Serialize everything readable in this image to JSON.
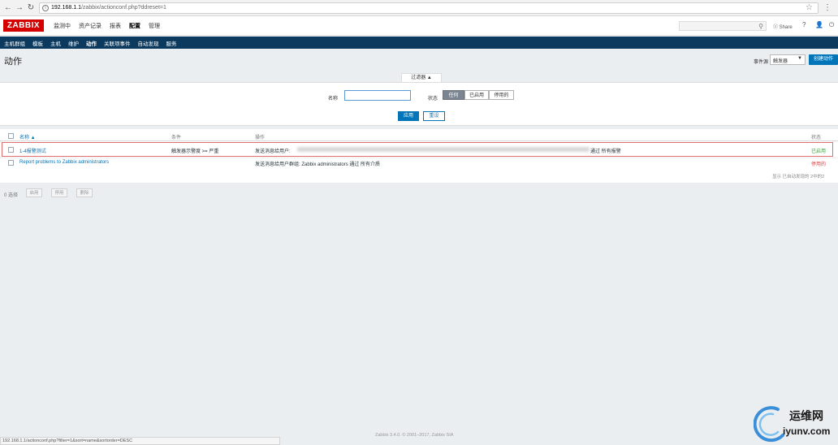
{
  "browser": {
    "url_host": "192.168.1.1",
    "url_path": "/zabbix/actionconf.php?ddreset=1",
    "back_icon": "arrow-left",
    "forward_icon": "arrow-right",
    "reload_icon": "reload"
  },
  "header": {
    "logo": "ZABBIX",
    "menu": [
      "监测中",
      "资产记录",
      "报表",
      "配置",
      "管理"
    ],
    "active_menu": "配置",
    "share": "Share",
    "help": "?",
    "user_icon": "user-icon",
    "power_icon": "power-icon"
  },
  "subnav": {
    "items": [
      "主机群组",
      "模板",
      "主机",
      "维护",
      "动作",
      "关联项事件",
      "自动发现",
      "服务"
    ],
    "active": "动作"
  },
  "page": {
    "title": "动作",
    "event_source_label": "事件源",
    "event_source_value": "触发器",
    "create_button": "创建动作"
  },
  "filter": {
    "tab_label": "过滤器 ▲",
    "name_label": "名称",
    "name_value": "",
    "status_label": "状态",
    "status_options": [
      "任何",
      "已启用",
      "停用的"
    ],
    "status_selected": "任何",
    "apply": "应用",
    "reset": "重设"
  },
  "table": {
    "columns": [
      "名称 ▲",
      "条件",
      "操作",
      "状态"
    ],
    "rows": [
      {
        "name": "1-4报警测试",
        "condition": "触发器示警度 >= 严重",
        "operation_prefix": "发送消息给用户:",
        "operation_suffix": "通过 所有报警",
        "status": "已启用"
      },
      {
        "name": "Report problems to Zabbix administrators",
        "condition": "",
        "operation_prefix": "发送消息给用户群组: Zabbix administrators 通过 所有介质",
        "operation_suffix": "",
        "status": "停用的"
      }
    ],
    "footer_note": "显示 已自动发现的 2中的2"
  },
  "actions_bar": {
    "selected": "0 选择",
    "buttons": [
      "启用",
      "停用",
      "删除"
    ]
  },
  "footer": {
    "copyright": "Zabbix 3.4.0. © 2001–2017, Zabbix SIA",
    "status_url": "192.168.1.1/actionconf.php?filter=1&sort=name&sortorder=DESC"
  },
  "watermark": {
    "text": "运维网",
    "url": "iyunv.com"
  },
  "colors": {
    "brand_red": "#d40000",
    "nav_blue": "#0b3a5e",
    "primary_button": "#0275b8",
    "status_enabled": "#3aa33a",
    "status_disabled": "#d64545"
  }
}
